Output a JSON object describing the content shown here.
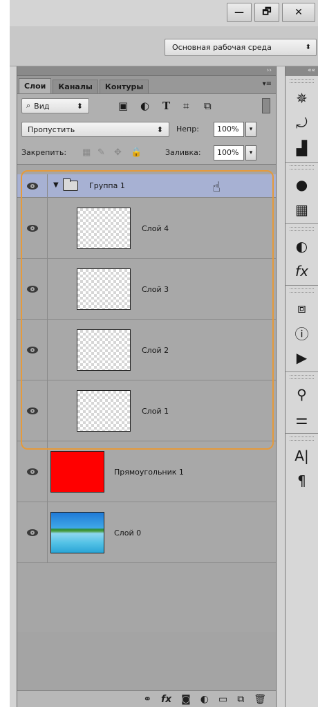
{
  "window": {
    "minimize": "—",
    "restore": "🗗",
    "close": "✕"
  },
  "workspace": {
    "label": "Основная рабочая среда"
  },
  "panel": {
    "collapse_arrows": "››",
    "tabs": [
      {
        "label": "Слои",
        "active": true
      },
      {
        "label": "Каналы",
        "active": false
      },
      {
        "label": "Контуры",
        "active": false
      }
    ],
    "kind_filter": "Вид",
    "blend_mode": "Пропустить",
    "opacity_label": "Непр:",
    "opacity_value": "100%",
    "lock_label": "Закрепить:",
    "fill_label": "Заливка:",
    "fill_value": "100%"
  },
  "layers": {
    "group": {
      "name": "Группа 1"
    },
    "items": [
      {
        "name": "Слой 4",
        "thumb": "transparent"
      },
      {
        "name": "Слой 3",
        "thumb": "transparent"
      },
      {
        "name": "Слой 2",
        "thumb": "transparent"
      },
      {
        "name": "Слой 1",
        "thumb": "transparent"
      },
      {
        "name": "Прямоугольник 1",
        "thumb": "red"
      },
      {
        "name": "Слой 0",
        "thumb": "photo"
      }
    ]
  },
  "colors": {
    "group_selection": "#a7b1d3",
    "highlight_outline": "#e69a3a",
    "shape_fill": "#ff0000"
  },
  "dock": {
    "collapse_arrows": "««",
    "icons": [
      "compass-icon",
      "history-icon",
      "histogram-icon",
      "color-palette-icon",
      "swatches-icon",
      "adjustments-icon",
      "styles-icon",
      "3d-icon",
      "info-icon",
      "actions-play-icon",
      "brush-presets-icon",
      "brush-settings-icon",
      "character-icon",
      "paragraph-icon"
    ]
  }
}
